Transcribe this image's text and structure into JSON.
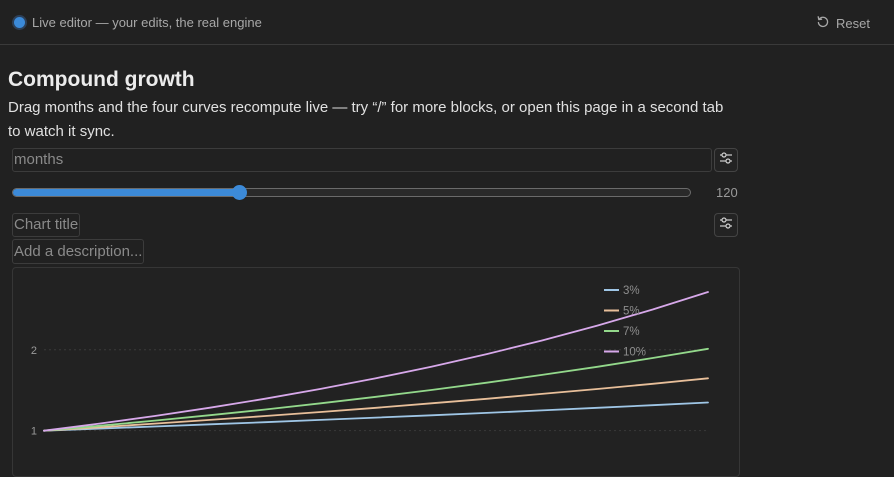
{
  "topbar": {
    "live_label": "Live editor — your edits, the real engine",
    "reset_label": "Reset",
    "accent": "#3b8ad9"
  },
  "page": {
    "title": "Compound growth",
    "description": "Drag months and the four curves recompute live — try “/” for more blocks, or open this page in a second tab to watch it sync."
  },
  "months_block": {
    "placeholder": "months",
    "slider_value": "120",
    "slider_fraction": 0.335
  },
  "chart_block": {
    "title_placeholder": "Chart title",
    "description_placeholder": "Add a description..."
  },
  "chart_data": {
    "type": "line",
    "x": [
      0,
      10,
      20,
      30,
      40,
      50,
      60,
      70,
      80,
      90,
      100,
      110,
      120
    ],
    "series": [
      {
        "name": "3%",
        "color": "#9fc6e6",
        "values": [
          1.0,
          1.025,
          1.051,
          1.078,
          1.105,
          1.133,
          1.161,
          1.19,
          1.22,
          1.251,
          1.283,
          1.315,
          1.348
        ]
      },
      {
        "name": "5%",
        "color": "#e8bf9a",
        "values": [
          1.0,
          1.042,
          1.087,
          1.133,
          1.181,
          1.231,
          1.283,
          1.338,
          1.394,
          1.454,
          1.515,
          1.579,
          1.647
        ]
      },
      {
        "name": "7%",
        "color": "#93d88b",
        "values": [
          1.0,
          1.06,
          1.124,
          1.191,
          1.262,
          1.338,
          1.418,
          1.503,
          1.593,
          1.689,
          1.79,
          1.898,
          2.012
        ]
      },
      {
        "name": "10%",
        "color": "#d7a8ea",
        "values": [
          1.0,
          1.087,
          1.181,
          1.284,
          1.395,
          1.516,
          1.648,
          1.791,
          1.946,
          2.115,
          2.299,
          2.498,
          2.715
        ]
      }
    ],
    "y_ticks": [
      "1",
      "2"
    ],
    "ylim": [
      0.6,
      2.9
    ],
    "xlim": [
      0,
      120
    ],
    "grid": true,
    "legend": "top-right",
    "title": "",
    "xlabel": "",
    "ylabel": ""
  }
}
